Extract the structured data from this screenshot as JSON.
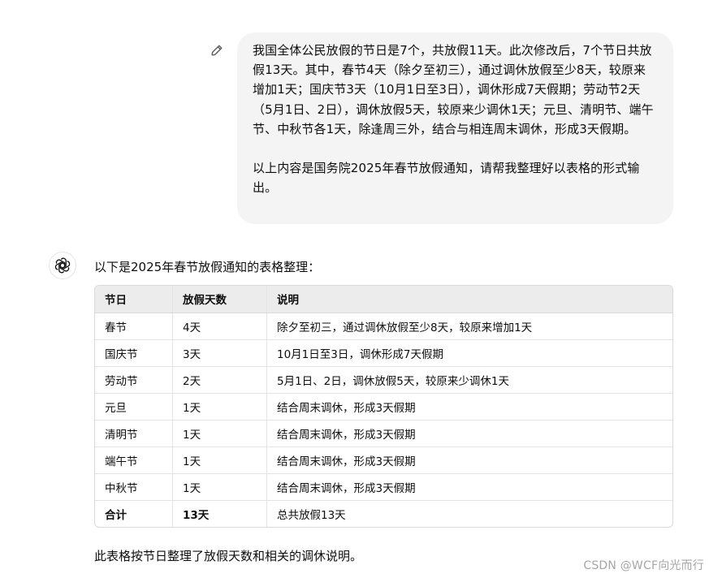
{
  "user_message": {
    "paragraphs": [
      "我国全体公民放假的节日是7个，共放假11天。此次修改后，7个节日共放假13天。其中，春节4天（除夕至初三），通过调休放假至少8天，较原来增加1天；国庆节3天（10月1日至3日），调休形成7天假期；劳动节2天（5月1日、2日），调休放假5天，较原来少调休1天；元旦、清明节、端午节、中秋节各1天，除逢周三外，结合与相连周末调休，形成3天假期。",
      "以上内容是国务院2025年春节放假通知，请帮我整理好以表格的形式输出。"
    ],
    "edit_icon": "pencil-icon"
  },
  "assistant": {
    "avatar_icon": "chatgpt-logo-icon",
    "intro": "以下是2025年春节放假通知的表格整理：",
    "table": {
      "headers": [
        "节日",
        "放假天数",
        "说明"
      ],
      "rows": [
        [
          "春节",
          "4天",
          "除夕至初三，通过调休放假至少8天，较原来增加1天"
        ],
        [
          "国庆节",
          "3天",
          "10月1日至3日，调休形成7天假期"
        ],
        [
          "劳动节",
          "2天",
          "5月1日、2日，调休放假5天，较原来少调休1天"
        ],
        [
          "元旦",
          "1天",
          "结合周末调休，形成3天假期"
        ],
        [
          "清明节",
          "1天",
          "结合周末调休，形成3天假期"
        ],
        [
          "端午节",
          "1天",
          "结合周末调休，形成3天假期"
        ],
        [
          "中秋节",
          "1天",
          "结合周末调休，形成3天假期"
        ]
      ],
      "total": [
        "合计",
        "13天",
        "总共放假13天"
      ]
    },
    "outro": "此表格按节日整理了放假天数和相关的调休说明。"
  },
  "watermark": "CSDN @WCF向光而行"
}
